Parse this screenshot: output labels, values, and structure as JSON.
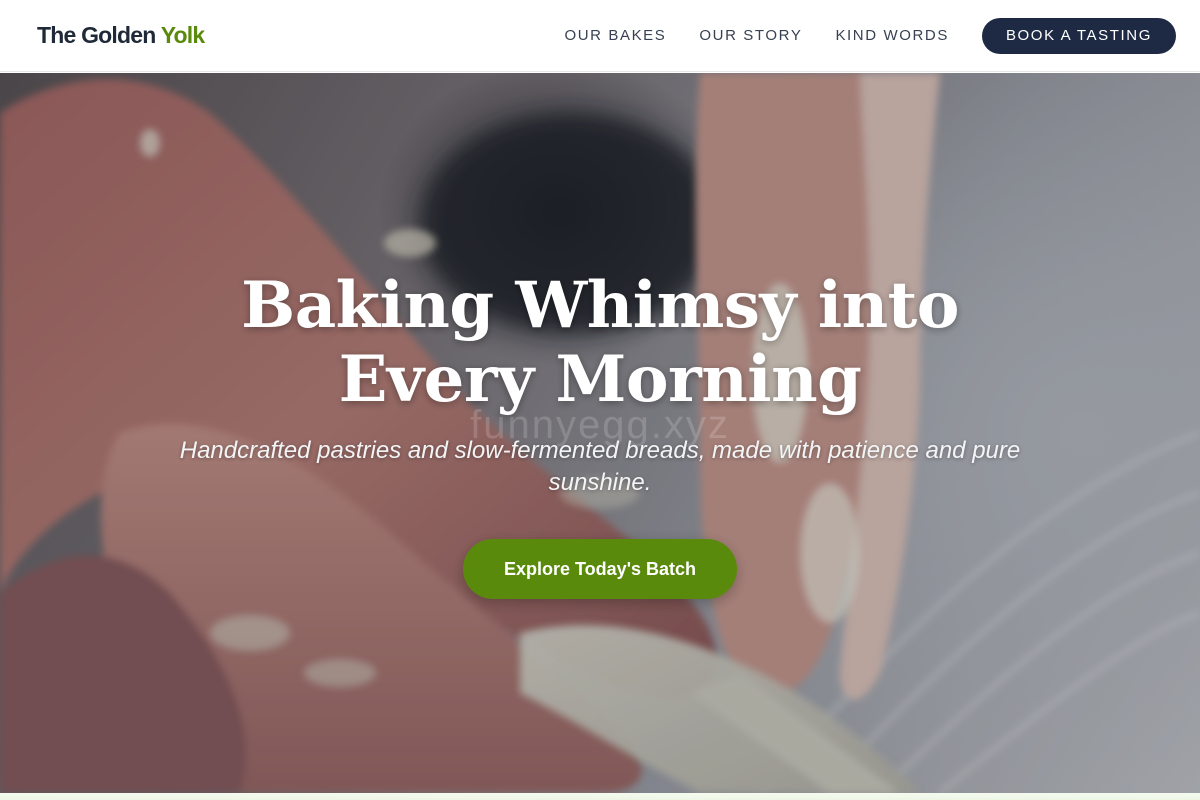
{
  "brand": {
    "name_part1": "The Golden ",
    "name_part2": "Yolk",
    "accent_color": "#5a8a0b"
  },
  "nav": {
    "items": [
      {
        "label": "OUR BAKES"
      },
      {
        "label": "OUR STORY"
      },
      {
        "label": "KIND WORDS"
      }
    ],
    "cta_label": "BOOK A TASTING",
    "cta_color": "#1e2a44"
  },
  "hero": {
    "title_line1": "Baking Whimsy into",
    "title_line2": "Every Morning",
    "subtitle": "Handcrafted pastries and slow-fermented breads, made with patience and pure sunshine.",
    "cta_label": "Explore Today's Batch",
    "watermark": "funnyegg.xyz",
    "image_description_icon": "hands-shaping-dough-image"
  }
}
